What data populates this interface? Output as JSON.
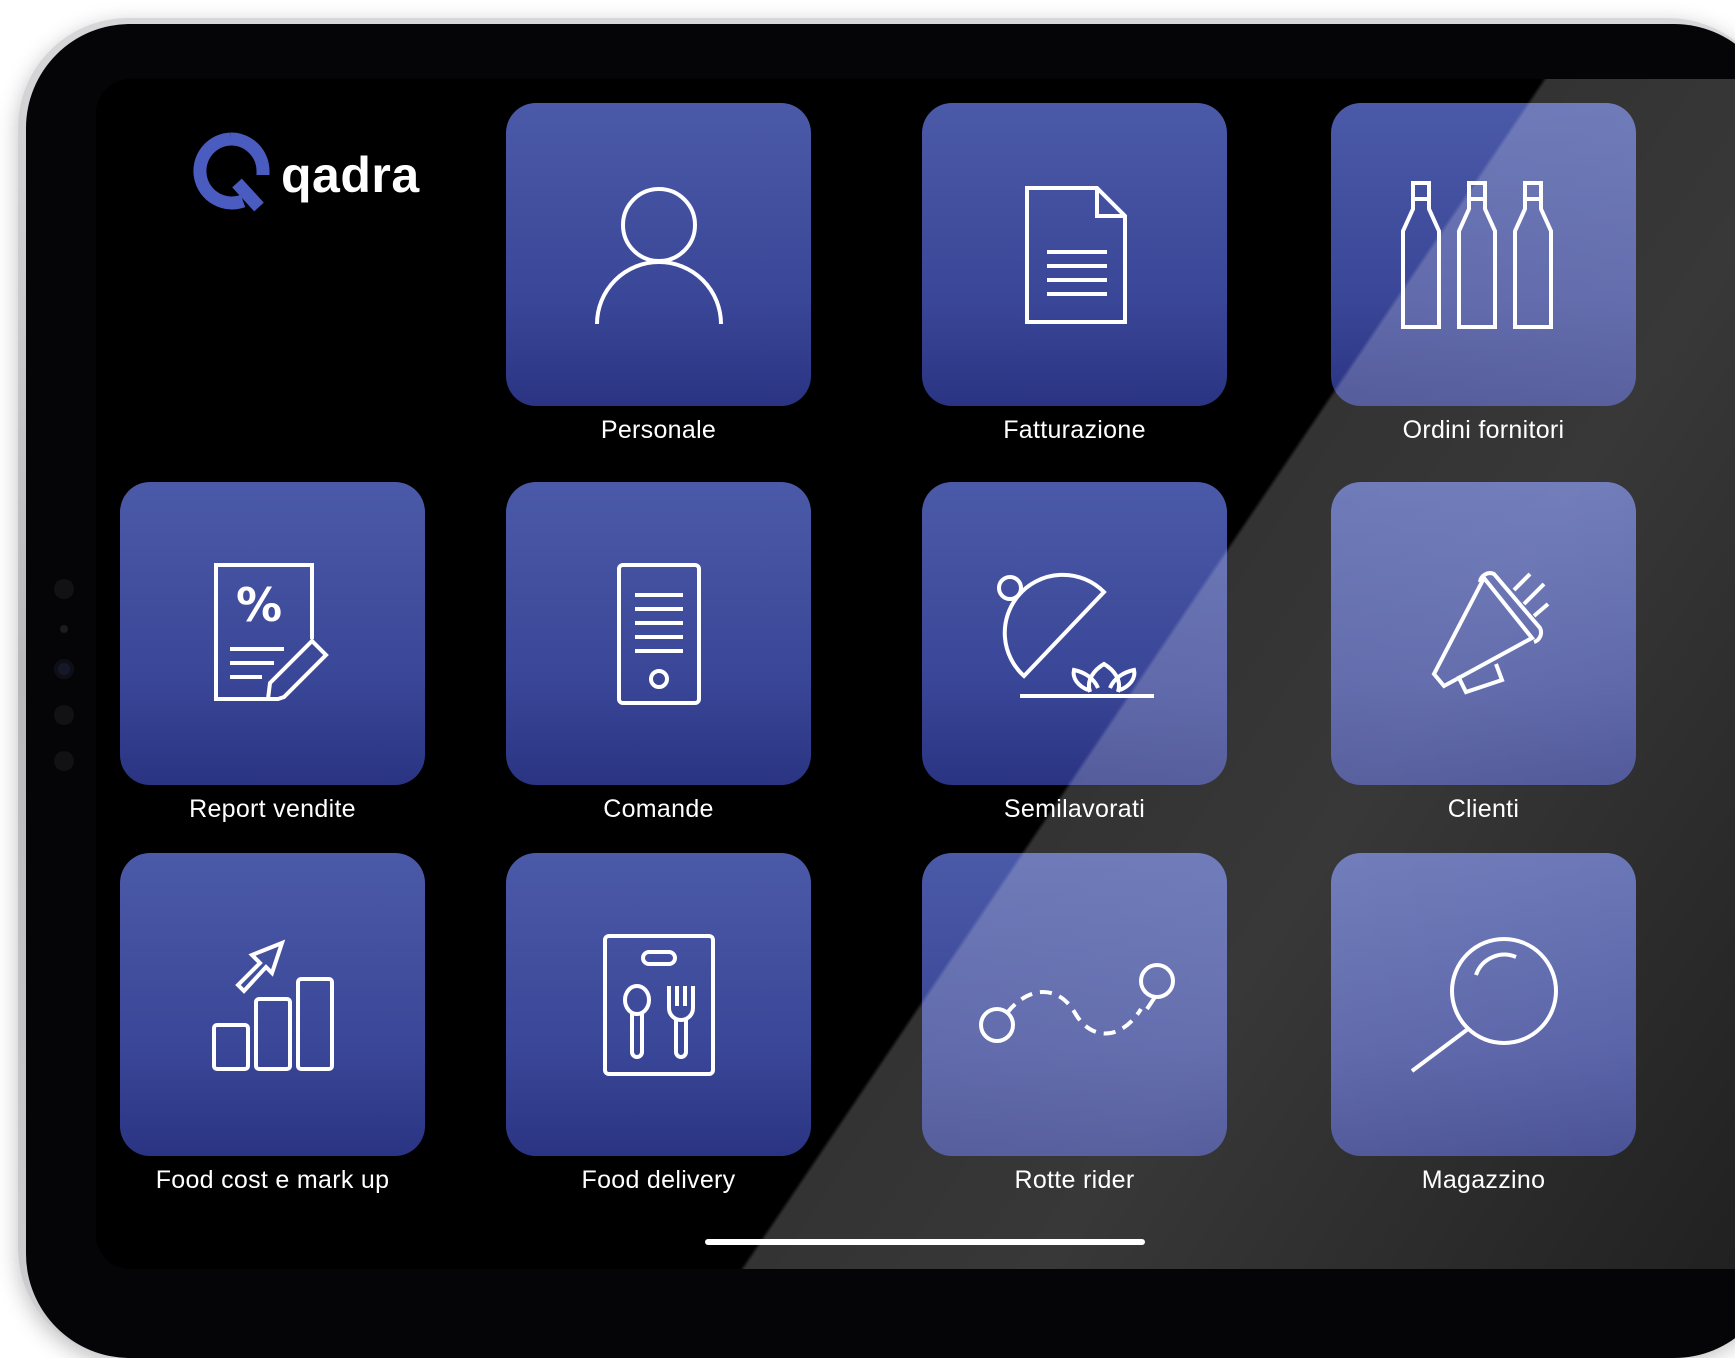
{
  "app": {
    "name": "qadra"
  },
  "tiles": [
    {
      "label": "Personale",
      "icon": "user-icon"
    },
    {
      "label": "Fatturazione",
      "icon": "document-icon"
    },
    {
      "label": "Ordini fornitori",
      "icon": "bottles-icon"
    },
    {
      "label": "Report vendite",
      "icon": "percent-report-icon"
    },
    {
      "label": "Comande",
      "icon": "order-ticket-icon"
    },
    {
      "label": "Semilavorati",
      "icon": "cloche-icon"
    },
    {
      "label": "Clienti",
      "icon": "megaphone-icon"
    },
    {
      "label": "Food cost e mark up",
      "icon": "growth-chart-icon"
    },
    {
      "label": "Food delivery",
      "icon": "delivery-bag-icon"
    },
    {
      "label": "Rotte rider",
      "icon": "route-icon"
    },
    {
      "label": "Magazzino",
      "icon": "magnifier-icon"
    }
  ],
  "colors": {
    "tile_top": "#4b5aa8",
    "tile_bottom": "#2a3483",
    "logo_blue": "#4a5cc0",
    "screen_bg": "#000000"
  }
}
